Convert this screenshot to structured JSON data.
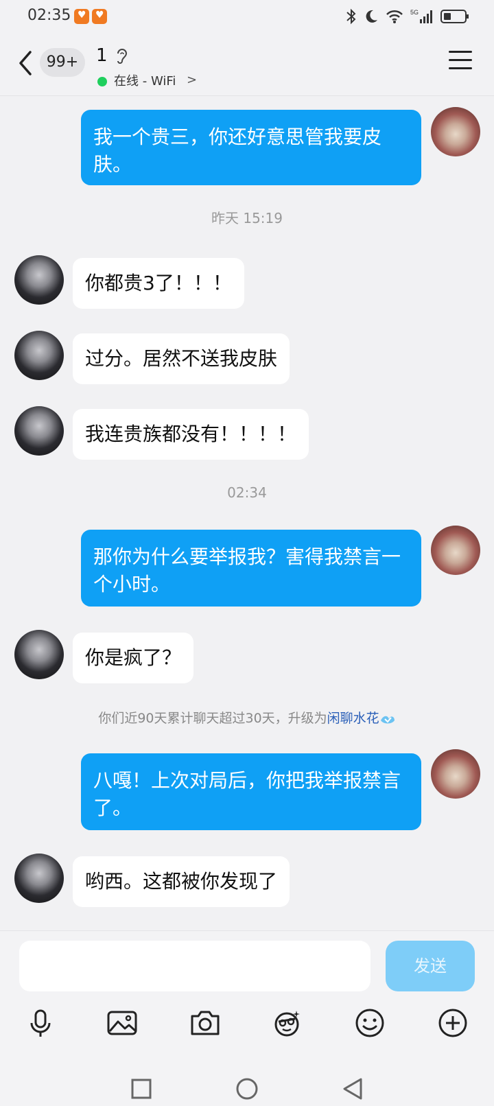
{
  "status_bar": {
    "time": "02:35",
    "signal_label": "5G"
  },
  "header": {
    "unread_count": "99+",
    "contact_name": "1",
    "online_status": "在线 - WiFi",
    "chevron": ">"
  },
  "messages": [
    {
      "from": "self",
      "text": "我一个贵三，你还好意思管我要皮肤。"
    },
    {
      "type": "time",
      "text": "昨天 15:19"
    },
    {
      "from": "other",
      "text": "你都贵3了！！！"
    },
    {
      "from": "other",
      "text": "过分。居然不送我皮肤"
    },
    {
      "from": "other",
      "text": "我连贵族都没有！！！！"
    },
    {
      "type": "time",
      "text": "02:34"
    },
    {
      "from": "self",
      "text": "那你为什么要举报我？害得我禁言一个小时。"
    },
    {
      "from": "other",
      "text": "你是疯了？"
    },
    {
      "type": "system",
      "text": "你们近90天累计聊天超过30天，升级为",
      "link": "闲聊水花"
    },
    {
      "from": "self",
      "text": "八嘎！上次对局后，你把我举报禁言了。"
    },
    {
      "from": "other",
      "text": "哟西。这都被你发现了"
    }
  ],
  "input": {
    "value": "",
    "send_label": "发送"
  },
  "toolbar": [
    "microphone-icon",
    "image-icon",
    "camera-icon",
    "sticker-icon",
    "emoji-icon",
    "plus-icon"
  ],
  "navbar": [
    "square-icon",
    "circle-icon",
    "triangle-icon"
  ],
  "colors": {
    "self_bubble": "#0fa0f5",
    "other_bubble": "#ffffff",
    "background": "#f1f1f3",
    "online": "#1fcf5d",
    "send_button": "#7ecdf8"
  }
}
